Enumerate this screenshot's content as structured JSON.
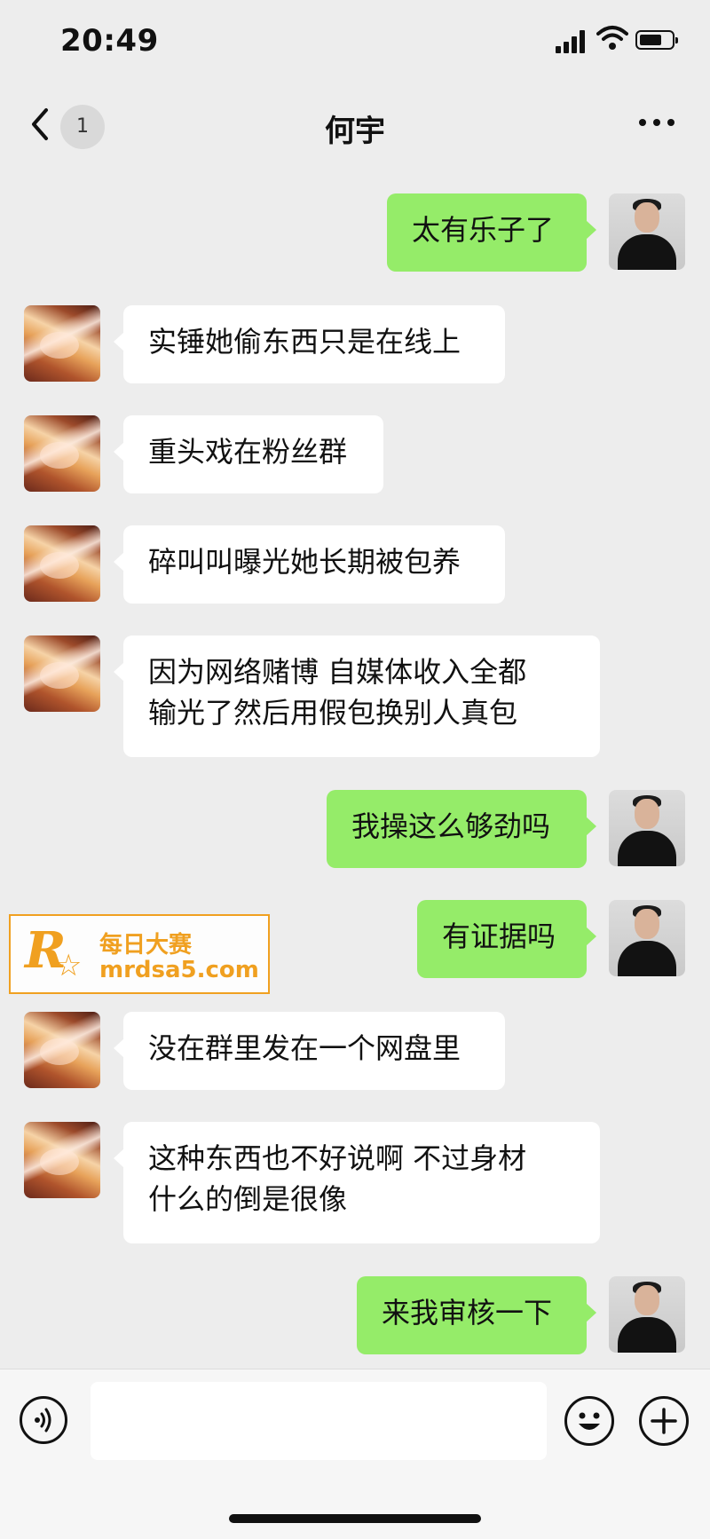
{
  "status_bar": {
    "time": "20:49"
  },
  "nav": {
    "unread_count": "1",
    "title": "何宇"
  },
  "messages": [
    {
      "side": "right",
      "text": "太有乐子了"
    },
    {
      "side": "left",
      "text": "实锤她偷东西只是在线上"
    },
    {
      "side": "left",
      "text": "重头戏在粉丝群"
    },
    {
      "side": "left",
      "text": "碎叫叫曝光她长期被包养"
    },
    {
      "side": "left",
      "text": "因为网络赌博 自媒体收入全都\n输光了然后用假包换别人真包"
    },
    {
      "side": "right",
      "text": "我操这么够劲吗"
    },
    {
      "side": "right",
      "text": "有证据吗"
    },
    {
      "side": "left",
      "text": "没在群里发在一个网盘里"
    },
    {
      "side": "left",
      "text": "这种东西也不好说啊 不过身材\n什么的倒是很像"
    },
    {
      "side": "right",
      "text": "来我审核一下"
    }
  ],
  "watermark": {
    "logo": "R",
    "name": "每日大赛",
    "url": "mrdsa5.com"
  },
  "colors": {
    "background": "#ededed",
    "my_bubble": "#95ec69",
    "their_bubble": "#ffffff",
    "watermark": "#f0a020"
  }
}
